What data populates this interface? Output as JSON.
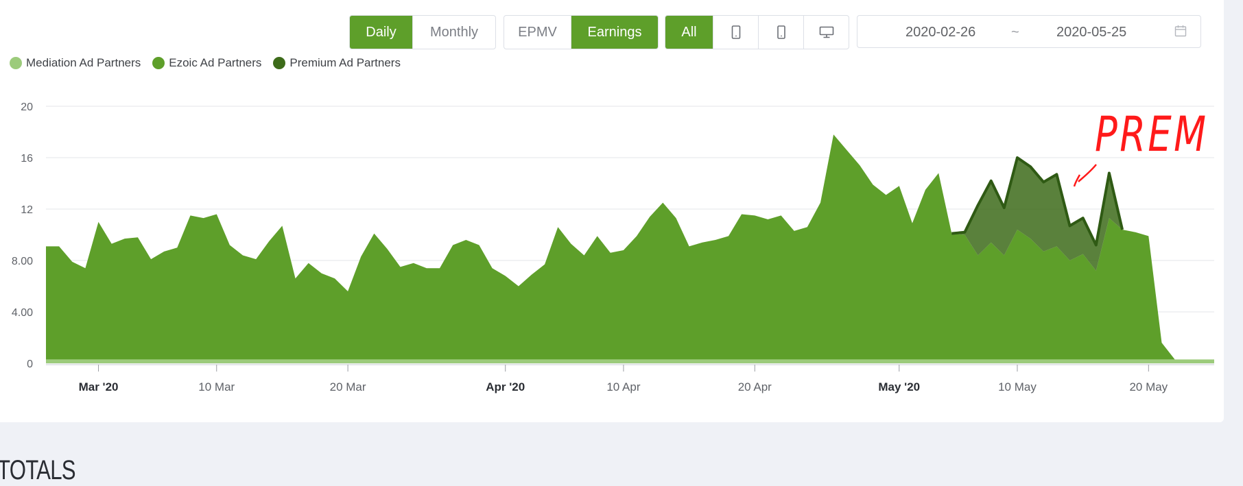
{
  "toolbar": {
    "period": {
      "daily": "Daily",
      "monthly": "Monthly",
      "selected": "Daily"
    },
    "metric": {
      "epmv": "EPMV",
      "earnings": "Earnings",
      "selected": "Earnings"
    },
    "device": {
      "all": "All",
      "tablet_icon": "tablet-icon",
      "phone_icon": "phone-icon",
      "desktop_icon": "desktop-icon",
      "selected": "All"
    },
    "date_range": {
      "start": "2020-02-26",
      "separator": "~",
      "end": "2020-05-25",
      "icon": "calendar-icon"
    }
  },
  "legend": [
    {
      "label": "Mediation Ad Partners",
      "color": "#9ccb7b"
    },
    {
      "label": "Ezoic Ad Partners",
      "color": "#5e9f2a"
    },
    {
      "label": "Premium Ad Partners",
      "color": "#3d6b1a"
    }
  ],
  "annotation": "PREM",
  "totals_heading": "TOTALS",
  "chart_data": {
    "type": "area",
    "stacked": true,
    "x_start": "2020-02-26",
    "x_end": "2020-05-25",
    "x_ticks": [
      {
        "label": "Mar '20",
        "date": "2020-03-01",
        "bold": true
      },
      {
        "label": "10 Mar",
        "date": "2020-03-10",
        "bold": false
      },
      {
        "label": "20 Mar",
        "date": "2020-03-20",
        "bold": false
      },
      {
        "label": "Apr '20",
        "date": "2020-04-01",
        "bold": true
      },
      {
        "label": "10 Apr",
        "date": "2020-04-10",
        "bold": false
      },
      {
        "label": "20 Apr",
        "date": "2020-04-20",
        "bold": false
      },
      {
        "label": "May '20",
        "date": "2020-05-01",
        "bold": true
      },
      {
        "label": "10 May",
        "date": "2020-05-10",
        "bold": false
      },
      {
        "label": "20 May",
        "date": "2020-05-20",
        "bold": false
      }
    ],
    "y_ticks": [
      {
        "value": 0,
        "label": "0"
      },
      {
        "value": 4,
        "label": "4.00"
      },
      {
        "value": 8,
        "label": "8.00"
      },
      {
        "value": 12,
        "label": "12"
      },
      {
        "value": 16,
        "label": "16"
      },
      {
        "value": 20,
        "label": "20"
      }
    ],
    "ylim": [
      0,
      20
    ],
    "grid": true,
    "legend_position": "top-left",
    "series": [
      {
        "name": "Mediation Ad Partners",
        "color": "#9ccb7b",
        "values": [
          0.3,
          0.3,
          0.3,
          0.3,
          0.3,
          0.3,
          0.3,
          0.3,
          0.3,
          0.3,
          0.3,
          0.3,
          0.3,
          0.3,
          0.3,
          0.3,
          0.3,
          0.3,
          0.3,
          0.3,
          0.3,
          0.3,
          0.3,
          0.3,
          0.3,
          0.3,
          0.3,
          0.3,
          0.3,
          0.3,
          0.3,
          0.3,
          0.3,
          0.3,
          0.3,
          0.3,
          0.3,
          0.3,
          0.3,
          0.3,
          0.3,
          0.3,
          0.3,
          0.3,
          0.3,
          0.3,
          0.3,
          0.3,
          0.3,
          0.3,
          0.3,
          0.3,
          0.3,
          0.3,
          0.3,
          0.3,
          0.3,
          0.3,
          0.3,
          0.3,
          0.3,
          0.3,
          0.3,
          0.3,
          0.3,
          0.3,
          0.3,
          0.3,
          0.3,
          0.3,
          0.3,
          0.3,
          0.3,
          0.3,
          0.3,
          0.3,
          0.3,
          0.3,
          0.3,
          0.3,
          0.3,
          0.3,
          0.3,
          0.3,
          0.3,
          0.3,
          0.3,
          0.3,
          0.3,
          0.3
        ]
      },
      {
        "name": "Ezoic Ad Partners",
        "color": "#5e9f2a",
        "values": [
          8.8,
          8.8,
          7.6,
          7.1,
          10.7,
          9.0,
          9.4,
          9.5,
          7.8,
          8.4,
          8.7,
          11.2,
          11.0,
          11.3,
          8.9,
          8.1,
          7.8,
          9.2,
          10.4,
          6.3,
          7.5,
          6.7,
          6.3,
          5.3,
          8.0,
          9.8,
          8.6,
          7.2,
          7.5,
          7.1,
          7.1,
          8.9,
          9.3,
          8.9,
          7.1,
          6.5,
          5.7,
          6.6,
          7.4,
          10.3,
          9.0,
          8.1,
          9.6,
          8.3,
          8.5,
          9.6,
          11.1,
          12.2,
          11.0,
          8.8,
          9.1,
          9.3,
          9.6,
          11.3,
          11.2,
          10.9,
          11.2,
          10.0,
          10.3,
          12.2,
          17.5,
          16.3,
          15.1,
          13.6,
          12.8,
          13.5,
          10.6,
          13.2,
          14.5,
          9.8,
          9.7,
          8.1,
          9.1,
          8.1,
          10.1,
          9.4,
          8.4,
          8.8,
          7.7,
          8.2,
          6.9,
          11.0,
          10.1,
          9.9,
          9.6,
          1.3,
          0,
          0,
          0,
          0
        ]
      },
      {
        "name": "Premium Ad Partners",
        "color": "#3d6b1a",
        "values": [
          0,
          0,
          0,
          0,
          0,
          0,
          0,
          0,
          0,
          0,
          0,
          0,
          0,
          0,
          0,
          0,
          0,
          0,
          0,
          0,
          0,
          0,
          0,
          0,
          0,
          0,
          0,
          0,
          0,
          0,
          0,
          0,
          0,
          0,
          0,
          0,
          0,
          0,
          0,
          0,
          0,
          0,
          0,
          0,
          0,
          0,
          0,
          0,
          0,
          0,
          0,
          0,
          0,
          0,
          0,
          0,
          0,
          0,
          0,
          0,
          0,
          0,
          0,
          0,
          0,
          0,
          0,
          0,
          0,
          0,
          0.2,
          3.9,
          4.8,
          3.7,
          5.6,
          5.6,
          5.4,
          5.6,
          2.7,
          2.8,
          2.0,
          3.5,
          0,
          0,
          0,
          0,
          0,
          0,
          0,
          0
        ]
      }
    ]
  }
}
